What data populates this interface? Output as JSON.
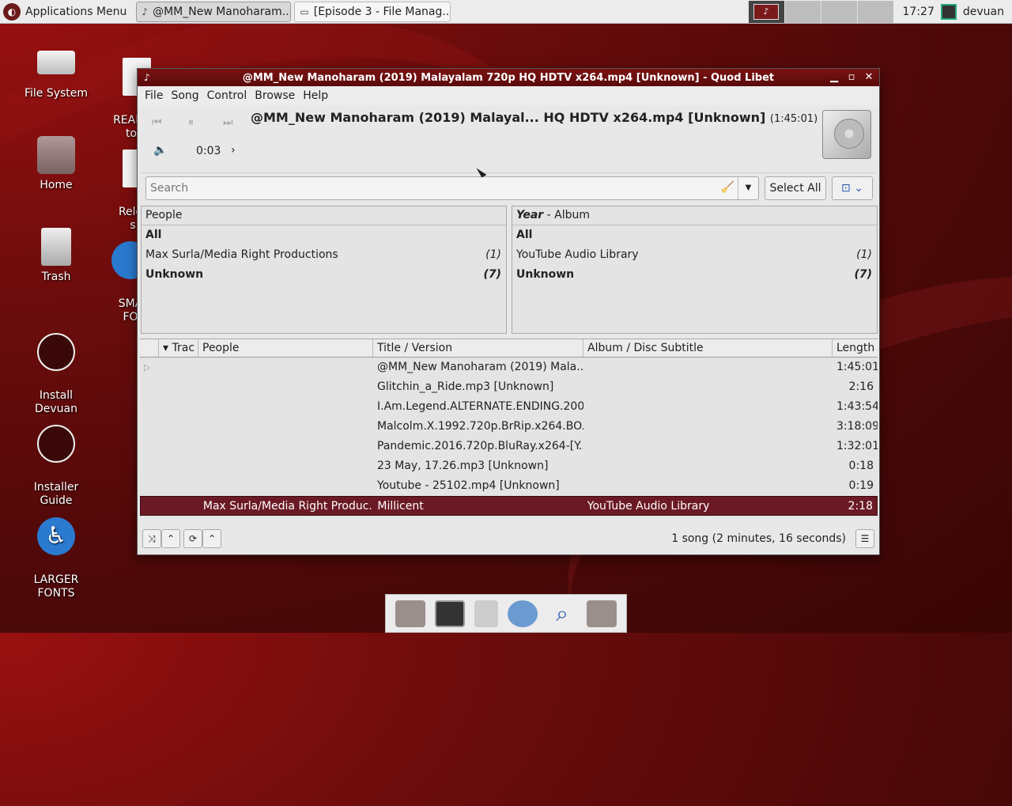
{
  "panel": {
    "apps_menu": "Applications Menu",
    "tasks": [
      "@MM_New Manoharam...",
      "[Episode 3 - File Manag..."
    ],
    "clock": "17:27",
    "user": "devuan"
  },
  "desktop": {
    "icons": [
      "File System",
      "Home",
      "Trash",
      "Install\nDevuan",
      "Installer\nGuide",
      "LARGER\nFONTS"
    ],
    "partial_icons": [
      "README\ntop-",
      "Releas\ns.t",
      "SMA\nFO"
    ]
  },
  "window": {
    "title": "@MM_New Manoharam (2019) Malayalam 720p HQ HDTV x264.mp4 [Unknown] - Quod Libet",
    "menu": [
      "File",
      "Song",
      "Control",
      "Browse",
      "Help"
    ],
    "now_playing": {
      "title": "@MM_New Manoharam (2019) Malayal... HQ HDTV x264.mp4 [Unknown]",
      "duration": "(1:45:01)",
      "position": "0:03"
    },
    "search": {
      "placeholder": "Search",
      "select_all": "Select All"
    },
    "people_pane": {
      "header": "People",
      "rows": [
        {
          "label": "All",
          "count": "",
          "bold": true
        },
        {
          "label": "Max Surla/Media Right Productions",
          "count": "(1)",
          "bold": false
        },
        {
          "label": "Unknown",
          "count": "(7)",
          "bold": true
        }
      ]
    },
    "album_pane": {
      "header_em": "Year",
      "header_rest": " - Album",
      "rows": [
        {
          "label": "All",
          "count": "",
          "bold": true
        },
        {
          "label": "YouTube Audio Library",
          "count": "(1)",
          "bold": false
        },
        {
          "label": "Unknown",
          "count": "(7)",
          "bold": true
        }
      ]
    },
    "song_columns": [
      "",
      "Trac",
      "People",
      "Title / Version",
      "Album / Disc Subtitle",
      "Length"
    ],
    "songs": [
      {
        "playing": true,
        "people": "",
        "title": "@MM_New Manoharam (2019) Mala...",
        "album": "",
        "length": "1:45:01"
      },
      {
        "playing": false,
        "people": "",
        "title": "Glitchin_a_Ride.mp3 [Unknown]",
        "album": "",
        "length": "2:16"
      },
      {
        "playing": false,
        "people": "",
        "title": "I.Am.Legend.ALTERNATE.ENDING.200...",
        "album": "",
        "length": "1:43:54"
      },
      {
        "playing": false,
        "people": "",
        "title": "Malcolm.X.1992.720p.BrRip.x264.BO...",
        "album": "",
        "length": "3:18:09"
      },
      {
        "playing": false,
        "people": "",
        "title": "Pandemic.2016.720p.BluRay.x264-[Y...",
        "album": "",
        "length": "1:32:01"
      },
      {
        "playing": false,
        "people": "",
        "title": "23 May, 17.26.mp3 [Unknown]",
        "album": "",
        "length": "0:18"
      },
      {
        "playing": false,
        "people": "",
        "title": "Youtube - 25102.mp4 [Unknown]",
        "album": "",
        "length": "0:19"
      },
      {
        "playing": false,
        "selected": true,
        "people": "Max Surla/Media Right Produc...",
        "title": "Millicent",
        "album": "YouTube Audio Library",
        "length": "2:18"
      }
    ],
    "status": "1 song (2 minutes, 16 seconds)"
  },
  "colors": {
    "accent": "#6b1a25",
    "titlebar": "#7a1212"
  }
}
